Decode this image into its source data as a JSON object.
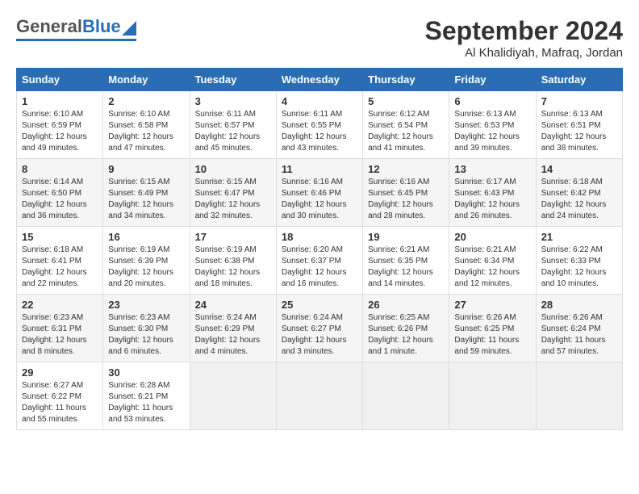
{
  "header": {
    "logo": {
      "part1": "General",
      "part2": "Blue"
    },
    "title": "September 2024",
    "subtitle": "Al Khalidiyah, Mafraq, Jordan"
  },
  "calendar": {
    "headers": [
      "Sunday",
      "Monday",
      "Tuesday",
      "Wednesday",
      "Thursday",
      "Friday",
      "Saturday"
    ],
    "weeks": [
      [
        {
          "day": "1",
          "info": "Sunrise: 6:10 AM\nSunset: 6:59 PM\nDaylight: 12 hours\nand 49 minutes."
        },
        {
          "day": "2",
          "info": "Sunrise: 6:10 AM\nSunset: 6:58 PM\nDaylight: 12 hours\nand 47 minutes."
        },
        {
          "day": "3",
          "info": "Sunrise: 6:11 AM\nSunset: 6:57 PM\nDaylight: 12 hours\nand 45 minutes."
        },
        {
          "day": "4",
          "info": "Sunrise: 6:11 AM\nSunset: 6:55 PM\nDaylight: 12 hours\nand 43 minutes."
        },
        {
          "day": "5",
          "info": "Sunrise: 6:12 AM\nSunset: 6:54 PM\nDaylight: 12 hours\nand 41 minutes."
        },
        {
          "day": "6",
          "info": "Sunrise: 6:13 AM\nSunset: 6:53 PM\nDaylight: 12 hours\nand 39 minutes."
        },
        {
          "day": "7",
          "info": "Sunrise: 6:13 AM\nSunset: 6:51 PM\nDaylight: 12 hours\nand 38 minutes."
        }
      ],
      [
        {
          "day": "8",
          "info": "Sunrise: 6:14 AM\nSunset: 6:50 PM\nDaylight: 12 hours\nand 36 minutes."
        },
        {
          "day": "9",
          "info": "Sunrise: 6:15 AM\nSunset: 6:49 PM\nDaylight: 12 hours\nand 34 minutes."
        },
        {
          "day": "10",
          "info": "Sunrise: 6:15 AM\nSunset: 6:47 PM\nDaylight: 12 hours\nand 32 minutes."
        },
        {
          "day": "11",
          "info": "Sunrise: 6:16 AM\nSunset: 6:46 PM\nDaylight: 12 hours\nand 30 minutes."
        },
        {
          "day": "12",
          "info": "Sunrise: 6:16 AM\nSunset: 6:45 PM\nDaylight: 12 hours\nand 28 minutes."
        },
        {
          "day": "13",
          "info": "Sunrise: 6:17 AM\nSunset: 6:43 PM\nDaylight: 12 hours\nand 26 minutes."
        },
        {
          "day": "14",
          "info": "Sunrise: 6:18 AM\nSunset: 6:42 PM\nDaylight: 12 hours\nand 24 minutes."
        }
      ],
      [
        {
          "day": "15",
          "info": "Sunrise: 6:18 AM\nSunset: 6:41 PM\nDaylight: 12 hours\nand 22 minutes."
        },
        {
          "day": "16",
          "info": "Sunrise: 6:19 AM\nSunset: 6:39 PM\nDaylight: 12 hours\nand 20 minutes."
        },
        {
          "day": "17",
          "info": "Sunrise: 6:19 AM\nSunset: 6:38 PM\nDaylight: 12 hours\nand 18 minutes."
        },
        {
          "day": "18",
          "info": "Sunrise: 6:20 AM\nSunset: 6:37 PM\nDaylight: 12 hours\nand 16 minutes."
        },
        {
          "day": "19",
          "info": "Sunrise: 6:21 AM\nSunset: 6:35 PM\nDaylight: 12 hours\nand 14 minutes."
        },
        {
          "day": "20",
          "info": "Sunrise: 6:21 AM\nSunset: 6:34 PM\nDaylight: 12 hours\nand 12 minutes."
        },
        {
          "day": "21",
          "info": "Sunrise: 6:22 AM\nSunset: 6:33 PM\nDaylight: 12 hours\nand 10 minutes."
        }
      ],
      [
        {
          "day": "22",
          "info": "Sunrise: 6:23 AM\nSunset: 6:31 PM\nDaylight: 12 hours\nand 8 minutes."
        },
        {
          "day": "23",
          "info": "Sunrise: 6:23 AM\nSunset: 6:30 PM\nDaylight: 12 hours\nand 6 minutes."
        },
        {
          "day": "24",
          "info": "Sunrise: 6:24 AM\nSunset: 6:29 PM\nDaylight: 12 hours\nand 4 minutes."
        },
        {
          "day": "25",
          "info": "Sunrise: 6:24 AM\nSunset: 6:27 PM\nDaylight: 12 hours\nand 3 minutes."
        },
        {
          "day": "26",
          "info": "Sunrise: 6:25 AM\nSunset: 6:26 PM\nDaylight: 12 hours\nand 1 minute."
        },
        {
          "day": "27",
          "info": "Sunrise: 6:26 AM\nSunset: 6:25 PM\nDaylight: 11 hours\nand 59 minutes."
        },
        {
          "day": "28",
          "info": "Sunrise: 6:26 AM\nSunset: 6:24 PM\nDaylight: 11 hours\nand 57 minutes."
        }
      ],
      [
        {
          "day": "29",
          "info": "Sunrise: 6:27 AM\nSunset: 6:22 PM\nDaylight: 11 hours\nand 55 minutes."
        },
        {
          "day": "30",
          "info": "Sunrise: 6:28 AM\nSunset: 6:21 PM\nDaylight: 11 hours\nand 53 minutes."
        },
        {
          "day": "",
          "info": ""
        },
        {
          "day": "",
          "info": ""
        },
        {
          "day": "",
          "info": ""
        },
        {
          "day": "",
          "info": ""
        },
        {
          "day": "",
          "info": ""
        }
      ]
    ]
  }
}
